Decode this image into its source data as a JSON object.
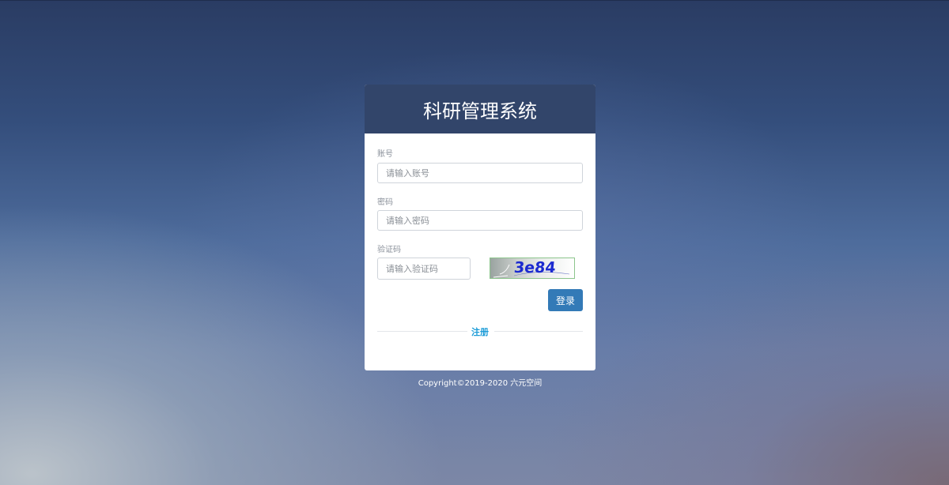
{
  "app": {
    "title": "科研管理系统"
  },
  "form": {
    "account": {
      "label": "账号",
      "placeholder": "请输入账号",
      "value": ""
    },
    "password": {
      "label": "密码",
      "placeholder": "请输入密码",
      "value": ""
    },
    "captcha": {
      "label": "验证码",
      "placeholder": "请输入验证码",
      "value": "",
      "image_text": "3e84"
    },
    "login_label": "登录",
    "register_label": "注册"
  },
  "footer": {
    "copyright": "Copyright©2019-2020 六元空间"
  },
  "colors": {
    "header_bg": "#32456a",
    "primary_button": "#337ab7",
    "link": "#1a9bd7",
    "captcha_text": "#1b2ad0"
  }
}
